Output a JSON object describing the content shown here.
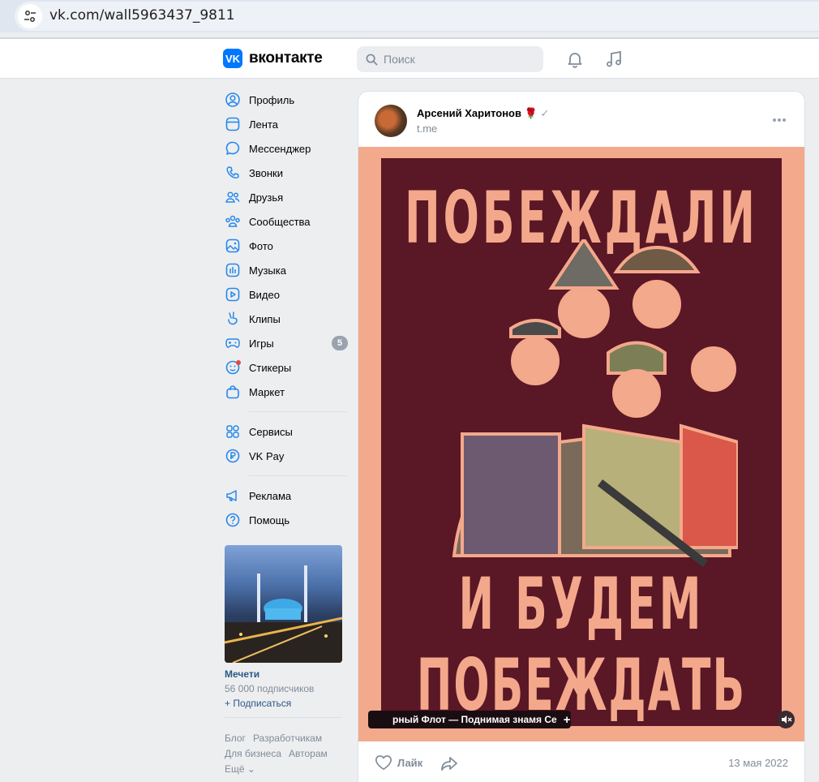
{
  "browser": {
    "url": "vk.com/wall5963437_9811"
  },
  "header": {
    "logo_text": "вконтакте",
    "logo_mark": "VK",
    "search_placeholder": "Поиск",
    "accent": "#0077ff"
  },
  "menu": {
    "main": [
      {
        "label": "Профиль",
        "icon": "profile-icon"
      },
      {
        "label": "Лента",
        "icon": "feed-icon"
      },
      {
        "label": "Мессенджер",
        "icon": "messenger-icon"
      },
      {
        "label": "Звонки",
        "icon": "phone-icon"
      },
      {
        "label": "Друзья",
        "icon": "friends-icon"
      },
      {
        "label": "Сообщества",
        "icon": "communities-icon"
      },
      {
        "label": "Фото",
        "icon": "photo-icon"
      },
      {
        "label": "Музыка",
        "icon": "music-icon"
      },
      {
        "label": "Видео",
        "icon": "video-icon"
      },
      {
        "label": "Клипы",
        "icon": "clips-icon"
      },
      {
        "label": "Игры",
        "icon": "games-icon",
        "badge": "5"
      },
      {
        "label": "Стикеры",
        "icon": "stickers-icon"
      },
      {
        "label": "Маркет",
        "icon": "market-icon"
      }
    ],
    "services": [
      {
        "label": "Сервисы",
        "icon": "services-icon"
      },
      {
        "label": "VK Pay",
        "icon": "vkpay-icon"
      }
    ],
    "other": [
      {
        "label": "Реклама",
        "icon": "ads-icon"
      },
      {
        "label": "Помощь",
        "icon": "help-icon"
      }
    ]
  },
  "promo": {
    "title": "Мечети",
    "subscribers": "56 000 подписчиков",
    "action": "+ Подписаться"
  },
  "footer": {
    "links": [
      "Блог",
      "Разработчикам",
      "Для бизнеса",
      "Авторам",
      "Ещё ⌄"
    ]
  },
  "post": {
    "author": "Арсений Харитонов",
    "source": "t.me",
    "poster_top": "ПОБЕЖДАЛИ",
    "poster_mid": "И БУДЕМ",
    "poster_bottom": "ПОБЕЖДАТЬ",
    "track": "рный Флот — Поднимая знамя   Се",
    "like_label": "Лайк",
    "date": "13 мая 2022"
  }
}
